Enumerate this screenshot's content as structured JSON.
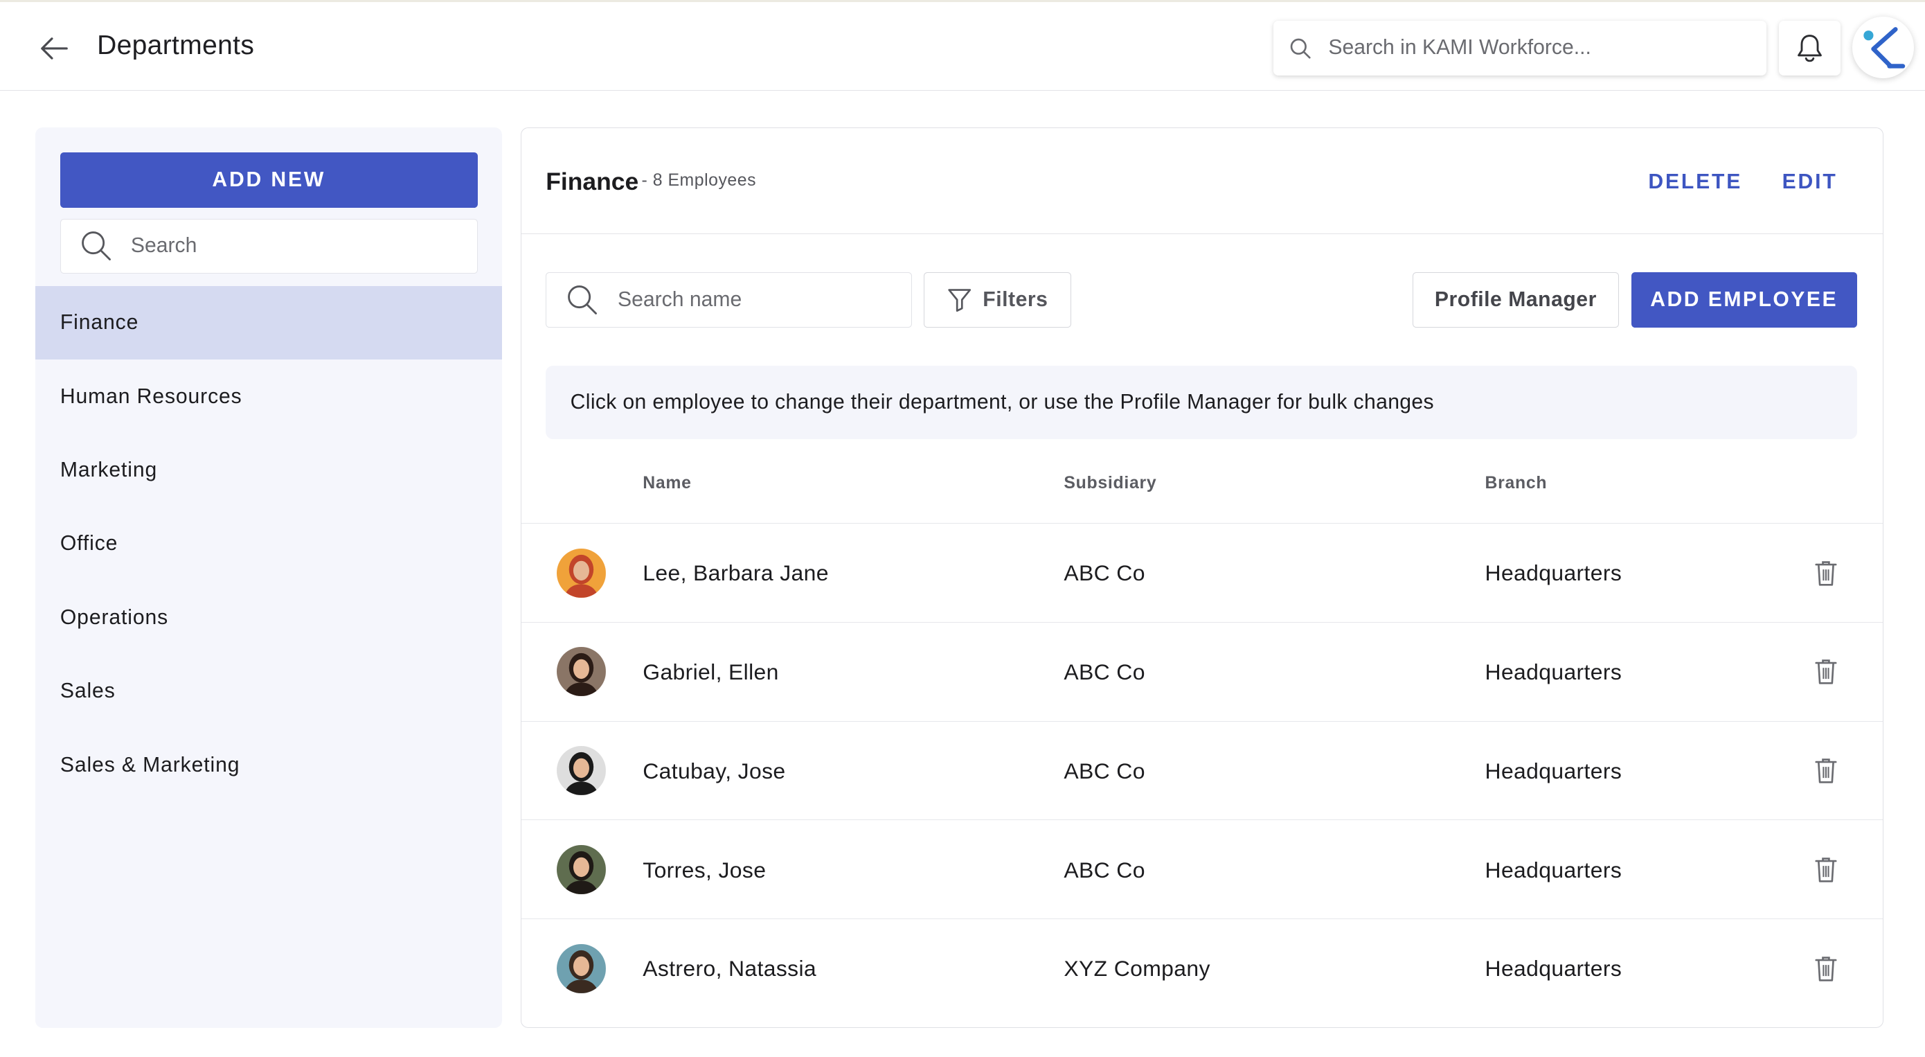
{
  "header": {
    "title": "Departments",
    "search_placeholder": "Search in KAMI Workforce..."
  },
  "sidebar": {
    "add_new_label": "ADD NEW",
    "search_placeholder": "Search",
    "departments": [
      {
        "label": "Finance",
        "active": true
      },
      {
        "label": "Human Resources"
      },
      {
        "label": "Marketing"
      },
      {
        "label": "Office"
      },
      {
        "label": "Operations"
      },
      {
        "label": "Sales"
      },
      {
        "label": "Sales & Marketing"
      }
    ]
  },
  "panel": {
    "department_name": "Finance",
    "employee_count": "- 8 Employees",
    "delete_label": "DELETE",
    "edit_label": "EDIT",
    "search_placeholder": "Search name",
    "filters_label": "Filters",
    "profile_manager_label": "Profile Manager",
    "add_employee_label": "ADD EMPLOYEE",
    "hint": "Click on employee to change their department, or use the Profile Manager for bulk changes",
    "columns": {
      "name": "Name",
      "subsidiary": "Subsidiary",
      "branch": "Branch"
    },
    "employees": [
      {
        "name": "Lee, Barbara Jane",
        "subsidiary": "ABC Co",
        "branch": "Headquarters",
        "avatar_bg": "#f0a23a",
        "avatar_hair": "#c2452a"
      },
      {
        "name": "Gabriel, Ellen",
        "subsidiary": "ABC Co",
        "branch": "Headquarters",
        "avatar_bg": "#8a7566",
        "avatar_hair": "#2b1c16"
      },
      {
        "name": "Catubay, Jose",
        "subsidiary": "ABC Co",
        "branch": "Headquarters",
        "avatar_bg": "#dedede",
        "avatar_hair": "#1a1a1a"
      },
      {
        "name": "Torres, Jose",
        "subsidiary": "ABC Co",
        "branch": "Headquarters",
        "avatar_bg": "#5f6d4f",
        "avatar_hair": "#1f1a16"
      },
      {
        "name": "Astrero, Natassia",
        "subsidiary": "XYZ Company",
        "branch": "Headquarters",
        "avatar_bg": "#6fa1b0",
        "avatar_hair": "#3a2a20"
      }
    ]
  },
  "colors": {
    "primary": "#4257c3",
    "active_item": "#d5daf1",
    "sidebar_bg": "#f5f6fc",
    "logo_blue": "#2f63c9",
    "logo_dot": "#36a7d6"
  },
  "icons": [
    "back-arrow-icon",
    "search-icon",
    "bell-icon",
    "kami-logo-icon",
    "filter-icon",
    "trash-icon"
  ]
}
